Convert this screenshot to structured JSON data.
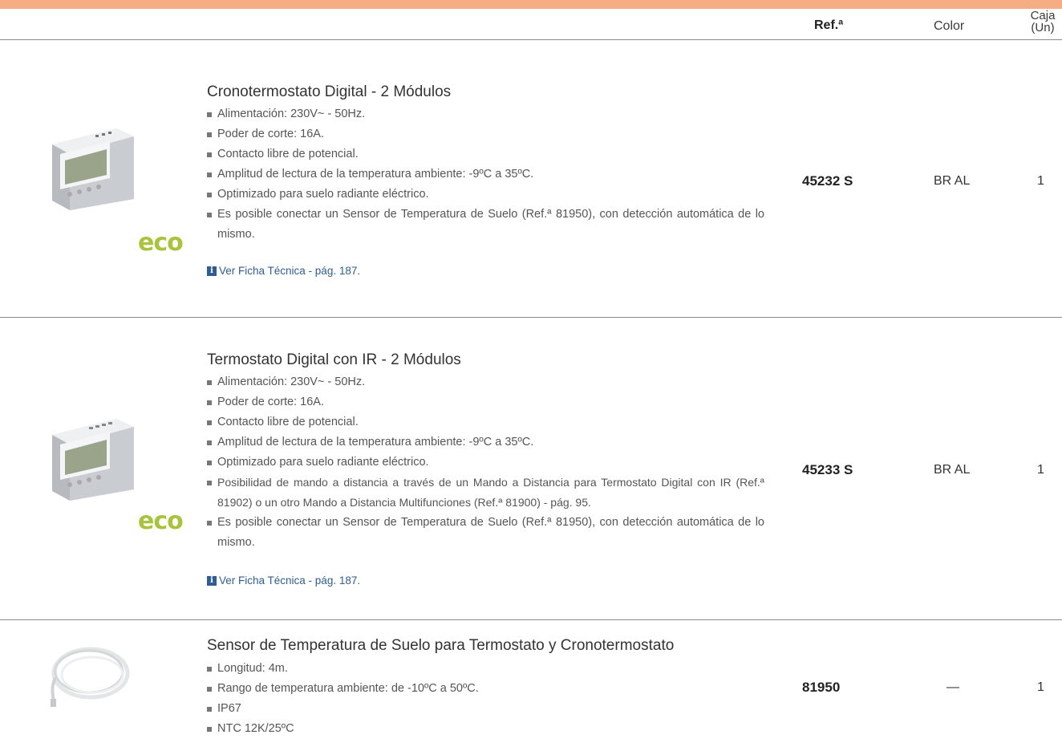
{
  "header": {
    "ref_label": "Ref.ª",
    "color_label": "Color",
    "caja_line1": "Caja",
    "caja_line2": "(Un)",
    "accent_color": "#f6ad84"
  },
  "products": [
    {
      "title": "Cronotermostato Digital - 2 Módulos",
      "features": [
        "Alimentación: 230V~ - 50Hz.",
        "Poder de corte: 16A.",
        "Contacto libre de potencial.",
        "Amplitud de lectura de la temperatura ambiente: -9ºC a 35ºC.",
        "Optimizado para suelo radiante eléctrico.",
        "Es posible conectar un Sensor de Temperatura de Suelo (Ref.ª 81950), con detección automática de lo mismo."
      ],
      "link": "Ver Ficha Técnica - pág. 187.",
      "badge": "eco",
      "ref": "45232 S",
      "color": "BR AL",
      "qty": "1"
    },
    {
      "title": "Termostato Digital con IR - 2 Módulos",
      "features": [
        "Alimentación: 230V~ - 50Hz.",
        "Poder de corte: 16A.",
        "Contacto libre de potencial.",
        "Amplitud de lectura de la temperatura ambiente: -9ºC a 35ºC.",
        "Optimizado para suelo radiante eléctrico.",
        "Posibilidad de mando a distancia a través de un Mando a Distancia para Termostato Digital con IR (Ref.ª 81902) o un otro Mando a Distancia Multifunciones (Ref.ª 81900) - pág. 95.",
        "Es posible conectar un Sensor de Temperatura de Suelo (Ref.ª 81950), con detección automática de lo mismo."
      ],
      "link": "Ver Ficha Técnica - pág. 187.",
      "badge": "eco",
      "ref": "45233 S",
      "color": "BR AL",
      "qty": "1"
    },
    {
      "title": "Sensor de Temperatura de Suelo para Termostato y Cronotermostato",
      "features": [
        "Longitud: 4m.",
        "Rango de temperatura ambiente: de -10ºC a 50ºC.",
        "IP67",
        "NTC 12K/25ºC"
      ],
      "ref": "81950",
      "color": "—",
      "qty": "1"
    }
  ]
}
